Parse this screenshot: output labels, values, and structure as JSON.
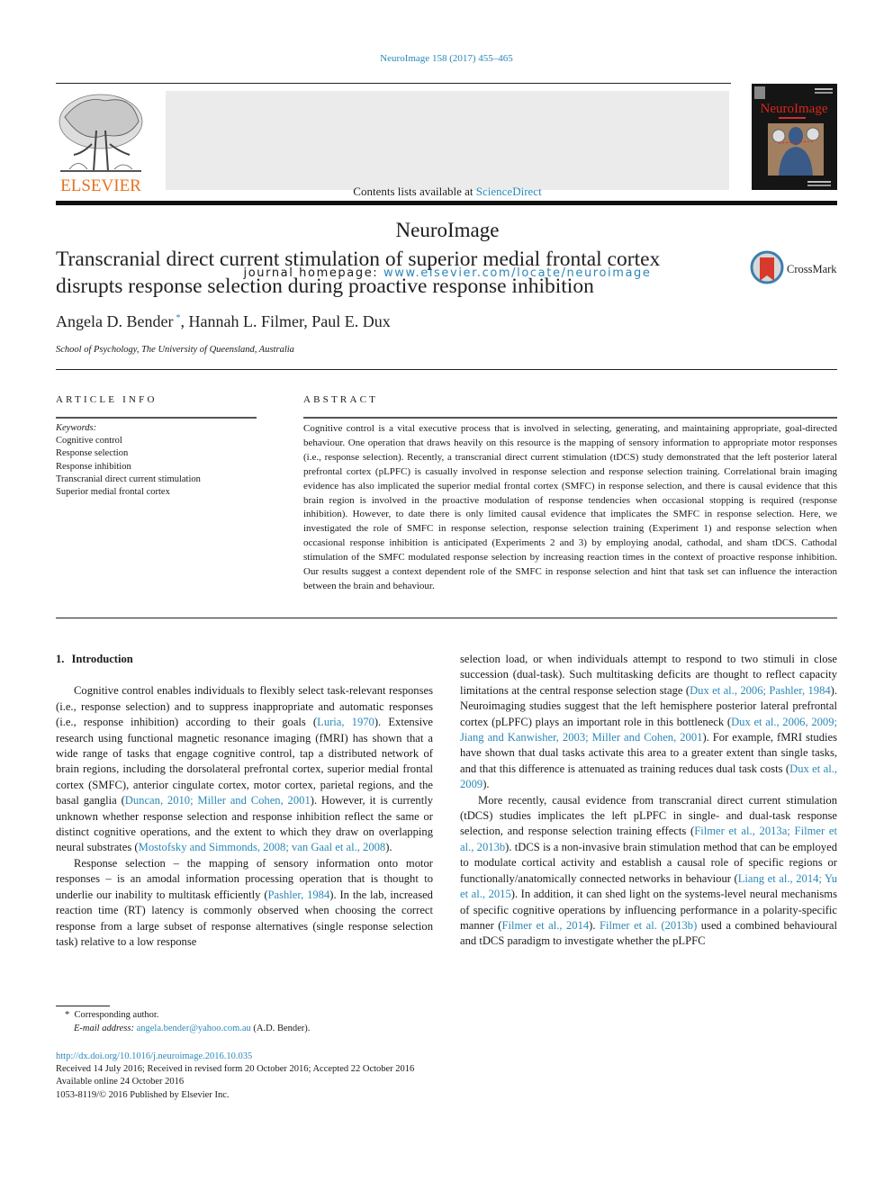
{
  "journal_ref": "NeuroImage 158 (2017) 455–465",
  "header": {
    "publisher_logo_text": "ELSEVIER",
    "contents_prefix": "Contents lists available at ",
    "contents_link": "ScienceDirect",
    "journal_name": "NeuroImage",
    "homepage_prefix": "journal homepage: ",
    "homepage_link": "www.elsevier.com/locate/neuroimage",
    "cover_title": "NeuroImage"
  },
  "article": {
    "title": "Transcranial direct current stimulation of superior medial frontal cortex disrupts response selection during proactive response inhibition",
    "crossmark_label": "CrossMark",
    "authors": [
      {
        "name": "Angela D. Bender",
        "mark": "*"
      },
      {
        "name": "Hannah L. Filmer"
      },
      {
        "name": "Paul E. Dux"
      }
    ],
    "author_sep": ", ",
    "affiliation": "School of Psychology, The University of Queensland, Australia"
  },
  "article_info": {
    "heading": "ARTICLE INFO",
    "keywords_label": "Keywords:",
    "keywords": [
      "Cognitive control",
      "Response selection",
      "Response inhibition",
      "Transcranial direct current stimulation",
      "Superior medial frontal cortex"
    ]
  },
  "abstract": {
    "heading": "ABSTRACT",
    "text": "Cognitive control is a vital executive process that is involved in selecting, generating, and maintaining appropriate, goal-directed behaviour. One operation that draws heavily on this resource is the mapping of sensory information to appropriate motor responses (i.e., response selection). Recently, a transcranial direct current stimulation (tDCS) study demonstrated that the left posterior lateral prefrontal cortex (pLPFC) is casually involved in response selection and response selection training. Correlational brain imaging evidence has also implicated the superior medial frontal cortex (SMFC) in response selection, and there is causal evidence that this brain region is involved in the proactive modulation of response tendencies when occasional stopping is required (response inhibition). However, to date there is only limited causal evidence that implicates the SMFC in response selection. Here, we investigated the role of SMFC in response selection, response selection training (Experiment 1) and response selection when occasional response inhibition is anticipated (Experiments 2 and 3) by employing anodal, cathodal, and sham tDCS. Cathodal stimulation of the SMFC modulated response selection by increasing reaction times in the context of proactive response inhibition. Our results suggest a context dependent role of the SMFC in response selection and hint that task set can influence the interaction between the brain and behaviour."
  },
  "introduction": {
    "number": "1.",
    "title": "Introduction",
    "paragraphs": [
      [
        {
          "t": "Cognitive control enables individuals to flexibly select task-relevant responses (i.e., response selection) and to suppress inappropriate and automatic responses (i.e., response inhibition) according to their goals ("
        },
        {
          "t": "Luria, 1970",
          "link": true
        },
        {
          "t": "). Extensive research using functional magnetic resonance imaging (fMRI) has shown that a wide range of tasks that engage cognitive control, tap a distributed network of brain regions, including the dorsolateral prefrontal cortex, superior medial frontal cortex (SMFC), anterior cingulate cortex, motor cortex, parietal regions, and the basal ganglia ("
        },
        {
          "t": "Duncan, 2010; Miller and Cohen, 2001",
          "link": true
        },
        {
          "t": "). However, it is currently unknown whether response selection and response inhibition reflect the same or distinct cognitive operations, and the extent to which they draw on overlapping neural substrates ("
        },
        {
          "t": "Mostofsky and Simmonds, 2008; van Gaal et al., 2008",
          "link": true
        },
        {
          "t": ")."
        }
      ],
      [
        {
          "t": "Response selection – the mapping of sensory information onto motor responses – is an amodal information processing operation that is thought to underlie our inability to multitask efficiently ("
        },
        {
          "t": "Pashler, 1984",
          "link": true
        },
        {
          "t": "). In the lab, increased reaction time (RT) latency is commonly observed when choosing the correct response from a large subset of response alternatives (single response selection task) relative to a low response selection load, or when individuals attempt to respond to two stimuli in close succession (dual-task). Such multitasking deficits are thought to reflect capacity limitations at the central response selection stage ("
        },
        {
          "t": "Dux et al., 2006; Pashler, 1984",
          "link": true
        },
        {
          "t": "). Neuroimaging studies suggest that the left hemisphere posterior lateral prefrontal cortex (pLPFC) plays an important role in this bottleneck ("
        },
        {
          "t": "Dux et al., 2006, 2009; Jiang and Kanwisher, 2003; Miller and Cohen, 2001",
          "link": true
        },
        {
          "t": "). For example, fMRI studies have shown that dual tasks activate this area to a greater extent than single tasks, and that this difference is attenuated as training reduces dual task costs ("
        },
        {
          "t": "Dux et al., 2009",
          "link": true
        },
        {
          "t": ")."
        }
      ],
      [
        {
          "t": "More recently, causal evidence from transcranial direct current stimulation (tDCS) studies implicates the left pLPFC in single- and dual-task response selection, and response selection training effects ("
        },
        {
          "t": "Filmer et al., 2013a; Filmer et al., 2013b",
          "link": true
        },
        {
          "t": "). tDCS is a non-invasive brain stimulation method that can be employed to modulate cortical activity and establish a causal role of specific regions or functionally/anatomically connected networks in behaviour ("
        },
        {
          "t": "Liang et al., 2014; Yu et al., 2015",
          "link": true
        },
        {
          "t": "). In addition, it can shed light on the systems-level neural mechanisms of specific cognitive operations by influencing performance in a polarity-specific manner ("
        },
        {
          "t": "Filmer et al., 2014",
          "link": true
        },
        {
          "t": "). "
        },
        {
          "t": "Filmer et al. (2013b)",
          "link": true
        },
        {
          "t": " used a combined behavioural and tDCS paradigm to investigate whether the pLPFC"
        }
      ]
    ]
  },
  "footnotes": {
    "mark": "*",
    "corresponding": "Corresponding author.",
    "email_label": "E-mail address:",
    "email": "angela.bender@yahoo.com.au",
    "email_suffix": " (A.D. Bender)."
  },
  "pubinfo": {
    "doi": "http://dx.doi.org/10.1016/j.neuroimage.2016.10.035",
    "history": "Received 14 July 2016; Received in revised form 20 October 2016; Accepted 22 October 2016",
    "online": "Available online 24 October 2016",
    "copyright": "1053-8119/© 2016 Published by Elsevier Inc."
  },
  "colors": {
    "link": "#2a88b8",
    "elsevier_orange": "#e9711c",
    "cover_title": "#d9261c"
  }
}
